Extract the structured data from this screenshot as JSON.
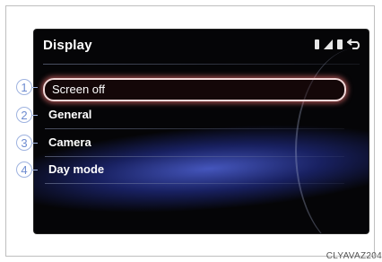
{
  "header": {
    "title": "Display",
    "status_icons": [
      "phone-icon",
      "signal-icon",
      "battery-icon",
      "back-icon"
    ]
  },
  "menu": {
    "items": [
      {
        "number": "1",
        "label": "Screen off",
        "selected": true
      },
      {
        "number": "2",
        "label": "General",
        "selected": false
      },
      {
        "number": "3",
        "label": "Camera",
        "selected": false
      },
      {
        "number": "4",
        "label": "Day mode",
        "selected": false
      }
    ]
  },
  "caption": "CLYAVAZ204",
  "colors": {
    "screen_background": "#050507",
    "selection_outline": "#f3d9d9",
    "accent_glow": "#3a4fc0",
    "callout": "#6d8bd0"
  }
}
